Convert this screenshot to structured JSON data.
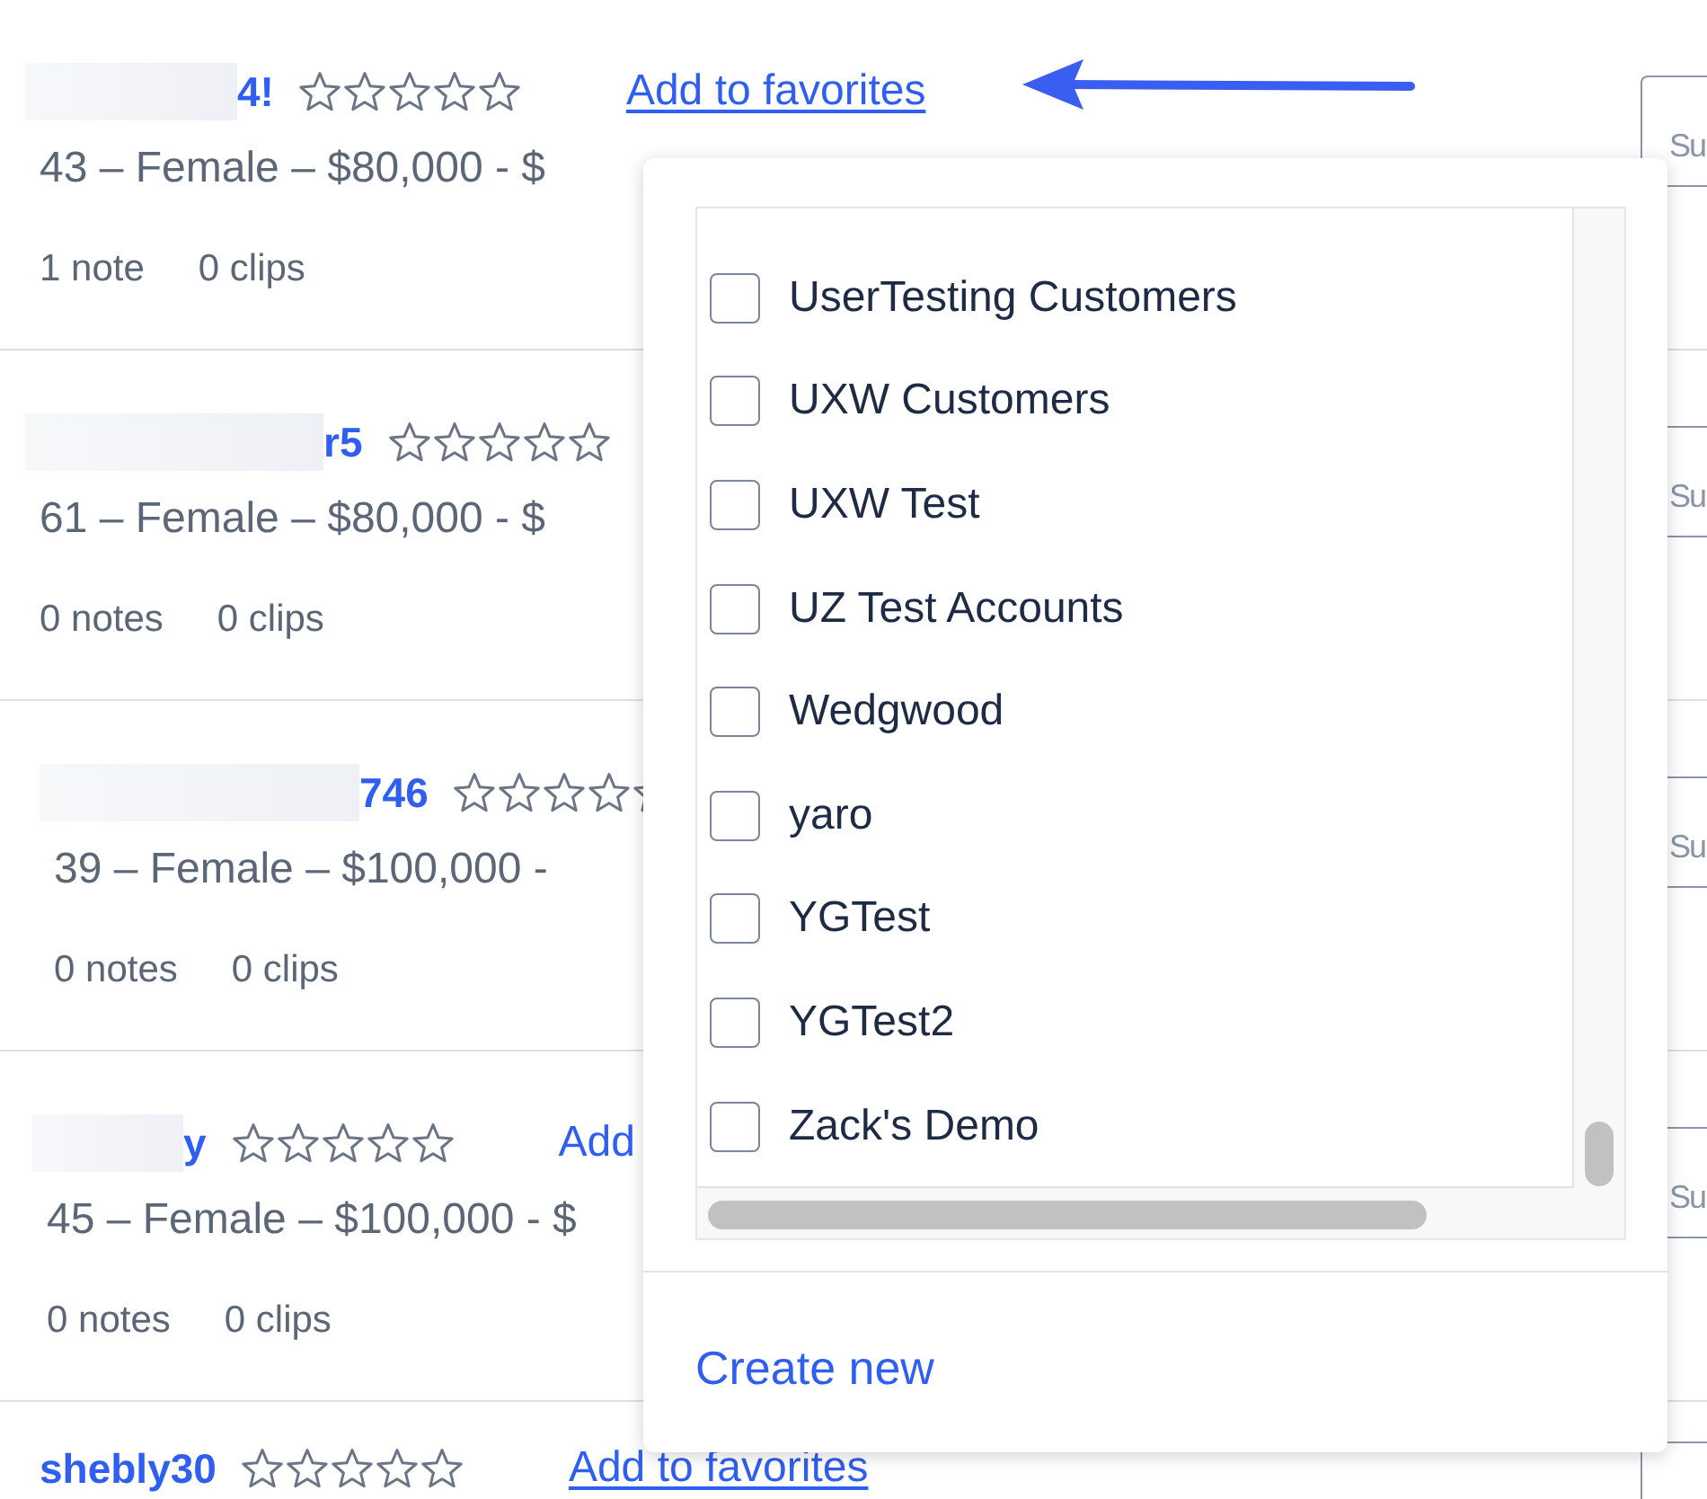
{
  "rows": [
    {
      "name": "4!",
      "redacted": true,
      "stars": 0,
      "favorite_link": "Add to favorites",
      "meta": "43 – Female – $80,000 - $",
      "notes": "1 note",
      "clips": "0 clips",
      "action": "Su"
    },
    {
      "name": "r5",
      "redacted": true,
      "stars": 0,
      "meta": "61 – Female – $80,000 - $",
      "notes": "0 notes",
      "clips": "0 clips",
      "action": "Su"
    },
    {
      "name": "746",
      "redacted": true,
      "stars": 0,
      "meta": "39 – Female – $100,000 -",
      "notes": "0 notes",
      "clips": "0 clips",
      "action": "Su"
    },
    {
      "name": "y",
      "redacted": true,
      "stars": 0,
      "favorite_link": "Add",
      "meta": "45 – Female – $100,000 - $",
      "notes": "0 notes",
      "clips": "0 clips",
      "action": "Su"
    },
    {
      "name": "shebly30",
      "redacted": false,
      "stars": 0,
      "favorite_link": "Add to favorites"
    }
  ],
  "favorites_popup": {
    "items": [
      {
        "label": "UserTesting Customers",
        "checked": false
      },
      {
        "label": "UXW Customers",
        "checked": false
      },
      {
        "label": "UXW Test",
        "checked": false
      },
      {
        "label": "UZ Test Accounts",
        "checked": false
      },
      {
        "label": "Wedgwood",
        "checked": false
      },
      {
        "label": "yaro",
        "checked": false
      },
      {
        "label": "YGTest",
        "checked": false
      },
      {
        "label": "YGTest2",
        "checked": false
      },
      {
        "label": "Zack's Demo",
        "checked": false
      }
    ],
    "create_link": "Create new"
  }
}
